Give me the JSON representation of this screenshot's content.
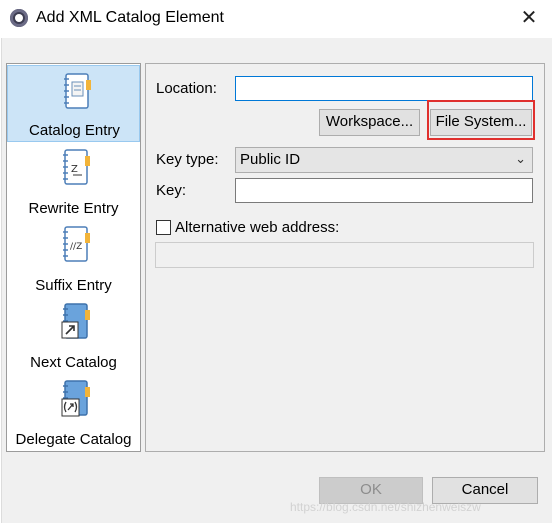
{
  "window": {
    "title": "Add XML Catalog Element"
  },
  "icons": {
    "app": "eclipse-app-icon",
    "close": "close-icon"
  },
  "element_list": {
    "items": [
      {
        "label": "Catalog Entry",
        "icon": "catalog-entry-icon",
        "selected": true
      },
      {
        "label": "Rewrite Entry",
        "icon": "rewrite-entry-icon",
        "selected": false
      },
      {
        "label": "Suffix Entry",
        "icon": "suffix-entry-icon",
        "selected": false
      },
      {
        "label": "Next Catalog",
        "icon": "next-catalog-icon",
        "selected": false
      },
      {
        "label": "Delegate Catalog",
        "icon": "delegate-catalog-icon",
        "selected": false
      }
    ]
  },
  "form": {
    "location_label": "Location:",
    "location_value": "",
    "workspace_button": "Workspace...",
    "filesystem_button": "File System...",
    "keytype_label": "Key type:",
    "keytype_value": "Public ID",
    "key_label": "Key:",
    "key_value": "",
    "alt_label": "Alternative web address:",
    "alt_checked": false,
    "alt_value": ""
  },
  "buttons": {
    "ok": "OK",
    "cancel": "Cancel"
  },
  "colors": {
    "selection": "#cce4f7",
    "highlight_box": "#e0302e",
    "focus_border": "#0078d7"
  },
  "watermark": "https://blog.csdn.net/shizhenweiszw"
}
